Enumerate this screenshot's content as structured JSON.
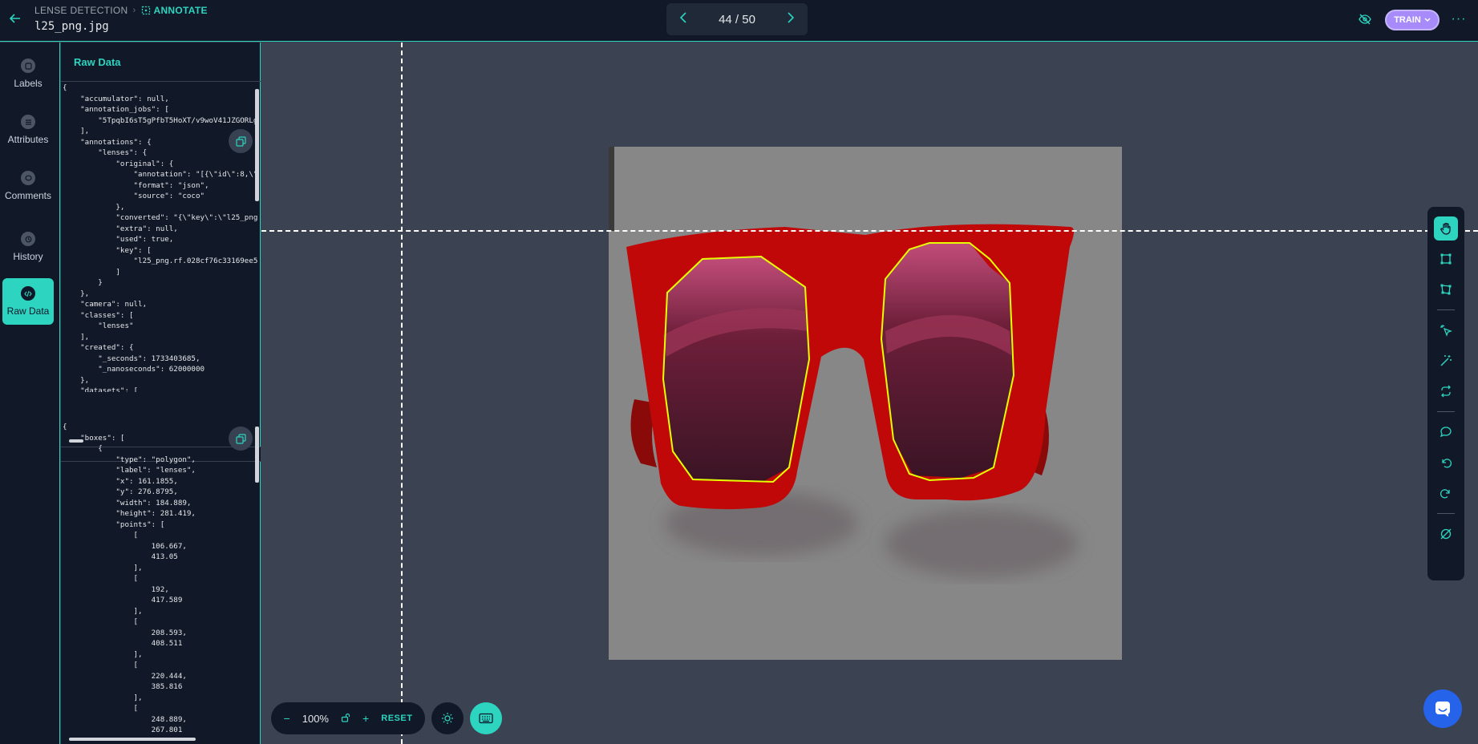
{
  "header": {
    "breadcrumb_project": "LENSE DETECTION",
    "breadcrumb_separator": "›",
    "breadcrumb_mode": "ANNOTATE",
    "file_name": "l25_png.jpg",
    "pager": {
      "current": "44 / 50"
    },
    "train_label": "TRAIN",
    "more_label": "···"
  },
  "nav": {
    "items": [
      {
        "label": "Labels",
        "icon": "tag-icon"
      },
      {
        "label": "Attributes",
        "icon": "list-icon"
      },
      {
        "label": "Comments",
        "icon": "comment-icon"
      },
      {
        "label": "History",
        "icon": "history-icon"
      },
      {
        "label": "Raw Data",
        "icon": "code-icon",
        "active": true
      }
    ]
  },
  "raw_panel": {
    "title": "Raw Data",
    "code_top": "{\n    \"accumulator\": null,\n    \"annotation_jobs\": [\n        \"5TpqbI6sT5gPfbT5HoXT/v9woV41JZGORLg\n    ],\n    \"annotations\": {\n        \"lenses\": {\n            \"original\": {\n                \"annotation\": \"[{\\\"id\\\":8,\\\"\n                \"format\": \"json\",\n                \"source\": \"coco\"\n            },\n            \"converted\": \"{\\\"key\\\":\\\"l25_png\n            \"extra\": null,\n            \"used\": true,\n            \"key\": [\n                \"l25_png.rf.028cf76c33169ee5\n            ]\n        }\n    },\n    \"camera\": null,\n    \"classes\": [\n        \"lenses\"\n    ],\n    \"created\": {\n        \"_seconds\": 1733403685,\n        \"_nanoseconds\": 62000000\n    },\n    \"datasets\": [",
    "code_bottom": "{\n    \"boxes\": [\n        {\n            \"type\": \"polygon\",\n            \"label\": \"lenses\",\n            \"x\": 161.1855,\n            \"y\": 276.8795,\n            \"width\": 184.889,\n            \"height\": 281.419,\n            \"points\": [\n                [\n                    106.667,\n                    413.05\n                ],\n                [\n                    192,\n                    417.589\n                ],\n                [\n                    208.593,\n                    408.511\n                ],\n                [\n                    220.444,\n                    385.816\n                ],\n                [\n                    248.889,\n                    267.801"
  },
  "zoom": {
    "value": "100%",
    "reset_label": "RESET",
    "minus": "−",
    "plus": "+"
  },
  "colors": {
    "accent": "#2dd4bf",
    "train": "#a78bfa",
    "polygon": "#e6ff00",
    "frame": "#c00000"
  }
}
